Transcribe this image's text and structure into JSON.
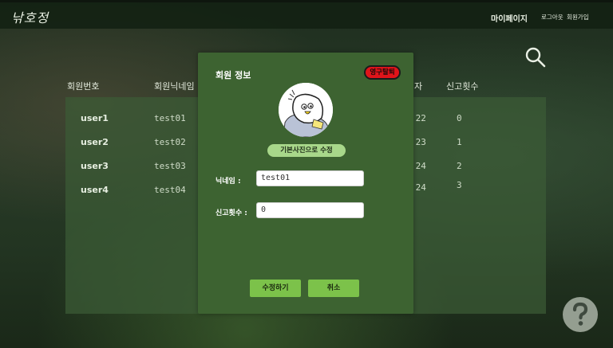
{
  "header": {
    "logo": "낚호정",
    "mypage": "마이페이지",
    "logout": "로그아웃",
    "signup": "회원가입"
  },
  "table": {
    "columns": [
      "회원번호",
      "회원닉네임",
      "자",
      "신고횟수"
    ],
    "rows": [
      {
        "id": "user1",
        "nickname": "test01",
        "date": ".22",
        "reports": "0"
      },
      {
        "id": "user2",
        "nickname": "test02",
        "date": ".23",
        "reports": "1"
      },
      {
        "id": "user3",
        "nickname": "test03",
        "date": ".24",
        "reports": "2"
      },
      {
        "id": "user4",
        "nickname": "test04",
        "date": ".24",
        "reports": "3"
      }
    ]
  },
  "modal": {
    "title": "회원 정보",
    "withdraw_label": "영구탈퇴",
    "default_photo_label": "기본사진으로 수정",
    "nickname_label": "닉네임 :",
    "nickname_value": "test01",
    "reports_label": "신고횟수 :",
    "reports_value": "0",
    "edit_label": "수정하기",
    "cancel_label": "취소"
  }
}
